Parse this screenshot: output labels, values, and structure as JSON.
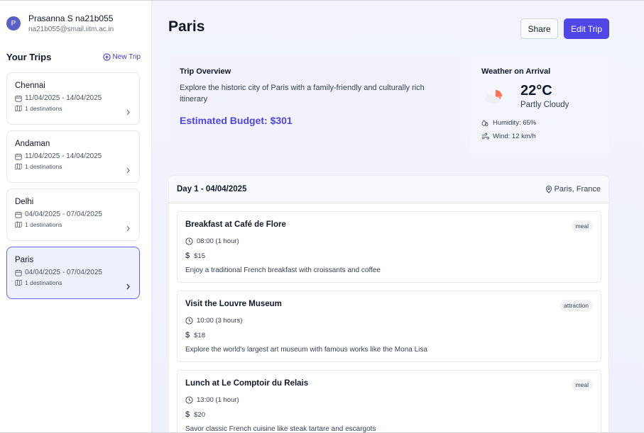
{
  "user": {
    "initial": "P",
    "name": "Prasanna S na21b055",
    "email": "na21b055@smail.iitm.ac.in"
  },
  "sidebar": {
    "title": "Your Trips",
    "new_trip_label": "New Trip",
    "trips": [
      {
        "name": "Chennai",
        "dates": "11/04/2025 - 14/04/2025",
        "destinations": "1 destinations"
      },
      {
        "name": "Andaman",
        "dates": "11/04/2025 - 14/04/2025",
        "destinations": "1 destinations"
      },
      {
        "name": "Delhi",
        "dates": "04/04/2025 - 07/04/2025",
        "destinations": "1 destinations"
      },
      {
        "name": "Paris",
        "dates": "04/04/2025 - 07/04/2025",
        "destinations": "1 destinations"
      }
    ]
  },
  "main": {
    "title": "Paris",
    "share_label": "Share",
    "edit_label": "Edit Trip",
    "overview": {
      "title": "Trip Overview",
      "description": "Explore the historic city of Paris with a family-friendly and culturally rich itinerary",
      "budget": "Estimated Budget: $301"
    },
    "weather": {
      "title": "Weather on Arrival",
      "temperature": "22°C",
      "condition": "Partly Cloudy",
      "humidity": "Humidity: 65%",
      "wind": "Wind: 12 km/h"
    },
    "day": {
      "title": "Day 1 - 04/04/2025",
      "location": "Paris, France",
      "activities": [
        {
          "title": "Breakfast at Café de Flore",
          "tag": "meal",
          "time": "08:00 (1 hour)",
          "cost": "$15",
          "description": "Enjoy a traditional French breakfast with croissants and coffee"
        },
        {
          "title": "Visit the Louvre Museum",
          "tag": "attraction",
          "time": "10:00 (3 hours)",
          "cost": "$18",
          "description": "Explore the world's largest art museum with famous works like the Mona Lisa"
        },
        {
          "title": "Lunch at Le Comptoir du Relais",
          "tag": "meal",
          "time": "13:00 (1 hour)",
          "cost": "$20",
          "description": "Savor classic French cuisine like steak tartare and escargots"
        }
      ]
    }
  },
  "colors": {
    "accent": "#4f46e5",
    "active_card_bg": "#eef0fb",
    "sun": "#f97355"
  }
}
